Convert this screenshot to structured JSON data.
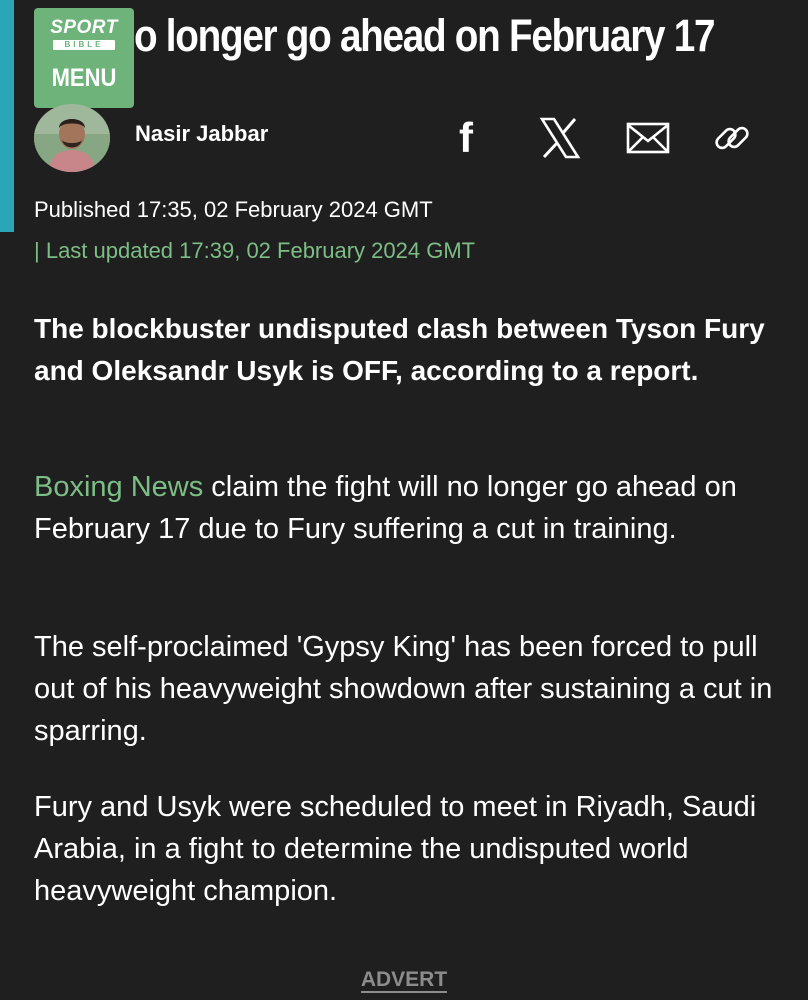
{
  "colors": {
    "background": "#1f1f1f",
    "accent_bar": "#2aa6b8",
    "brand_green": "#6db37a",
    "link_green": "#7dbd86",
    "advert_gray": "#8c8c8c"
  },
  "header": {
    "headline": "o longer go ahead on February 17",
    "logo": {
      "sport": "SPORT",
      "bible": "BIBLE",
      "menu_label": "MENU"
    }
  },
  "byline": {
    "author": "Nasir Jabbar",
    "share_icons": [
      "facebook-icon",
      "x-icon",
      "mail-icon",
      "link-icon"
    ],
    "facebook_glyph": "f"
  },
  "meta": {
    "published": "Published 17:35, 02 February 2024 GMT",
    "updated": "| Last updated 17:39, 02 February 2024 GMT"
  },
  "article": {
    "lead": "The blockbuster undisputed clash between Tyson Fury and Oleksandr Usyk is OFF, according to a report.",
    "para1_link": "Boxing News",
    "para1_rest": " claim the fight will no longer go ahead on February 17 due to Fury suffering a cut in training.",
    "para2": "The self-proclaimed 'Gypsy King' has been forced to pull out of his heavyweight showdown after sustaining a cut in sparring.",
    "para3": "Fury and Usyk were scheduled to meet in Riyadh, Saudi Arabia, in a fight to determine the undisputed world heavyweight champion."
  },
  "advert": {
    "label": "ADVERT"
  }
}
